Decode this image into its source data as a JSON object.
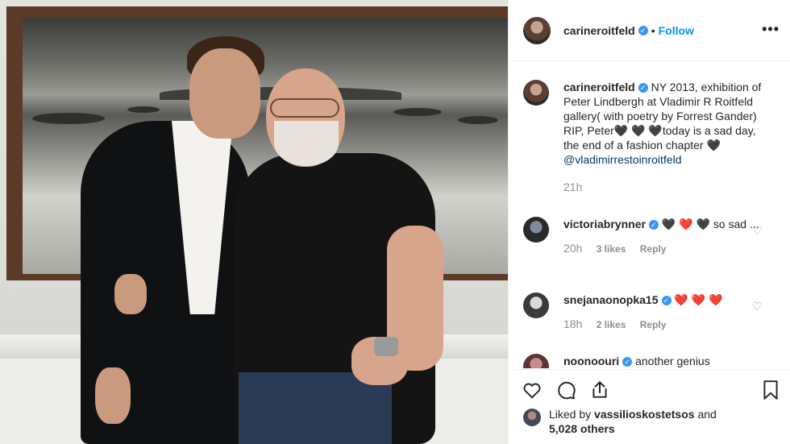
{
  "post": {
    "username": "carineroitfeld",
    "follow_label": "Follow",
    "dot": "•",
    "more_label": "•••"
  },
  "caption": {
    "username": "carineroitfeld",
    "line1": "NY 2013, exhibition of Peter Lindbergh at Vladimir R Roitfeld gallery( with poetry by Forrest Gander)",
    "line2a": "RIP, Peter",
    "hearts": "🖤 🖤 🖤",
    "line2b": "today is a sad day, the end of a fashion chapter",
    "heart_end": "🖤",
    "mention": "@vladimirrestoinroitfeld",
    "time": "21h"
  },
  "comments": [
    {
      "username": "victoriabrynner",
      "text_hearts": "🖤 ❤️ 🖤",
      "text": "so sad ...",
      "time": "20h",
      "likes": "3 likes",
      "reply": "Reply"
    },
    {
      "username": "snejanaonopka15",
      "text_hearts": "❤️ ❤️ ❤️",
      "text": "",
      "time": "18h",
      "likes": "2 likes",
      "reply": "Reply"
    },
    {
      "username": "noonoouri",
      "text": "another genius"
    }
  ],
  "liked_by": {
    "prefix": "Liked by",
    "user": "vassilioskostetsos",
    "suffix": "and",
    "others": "5,028 others"
  },
  "icons": [
    "heart-icon",
    "comment-icon",
    "share-icon",
    "bookmark-icon",
    "more-icon",
    "verified-icon"
  ],
  "colors": {
    "link": "#0095f6",
    "verified": "#3897f0",
    "muted": "#8e8e8e"
  }
}
